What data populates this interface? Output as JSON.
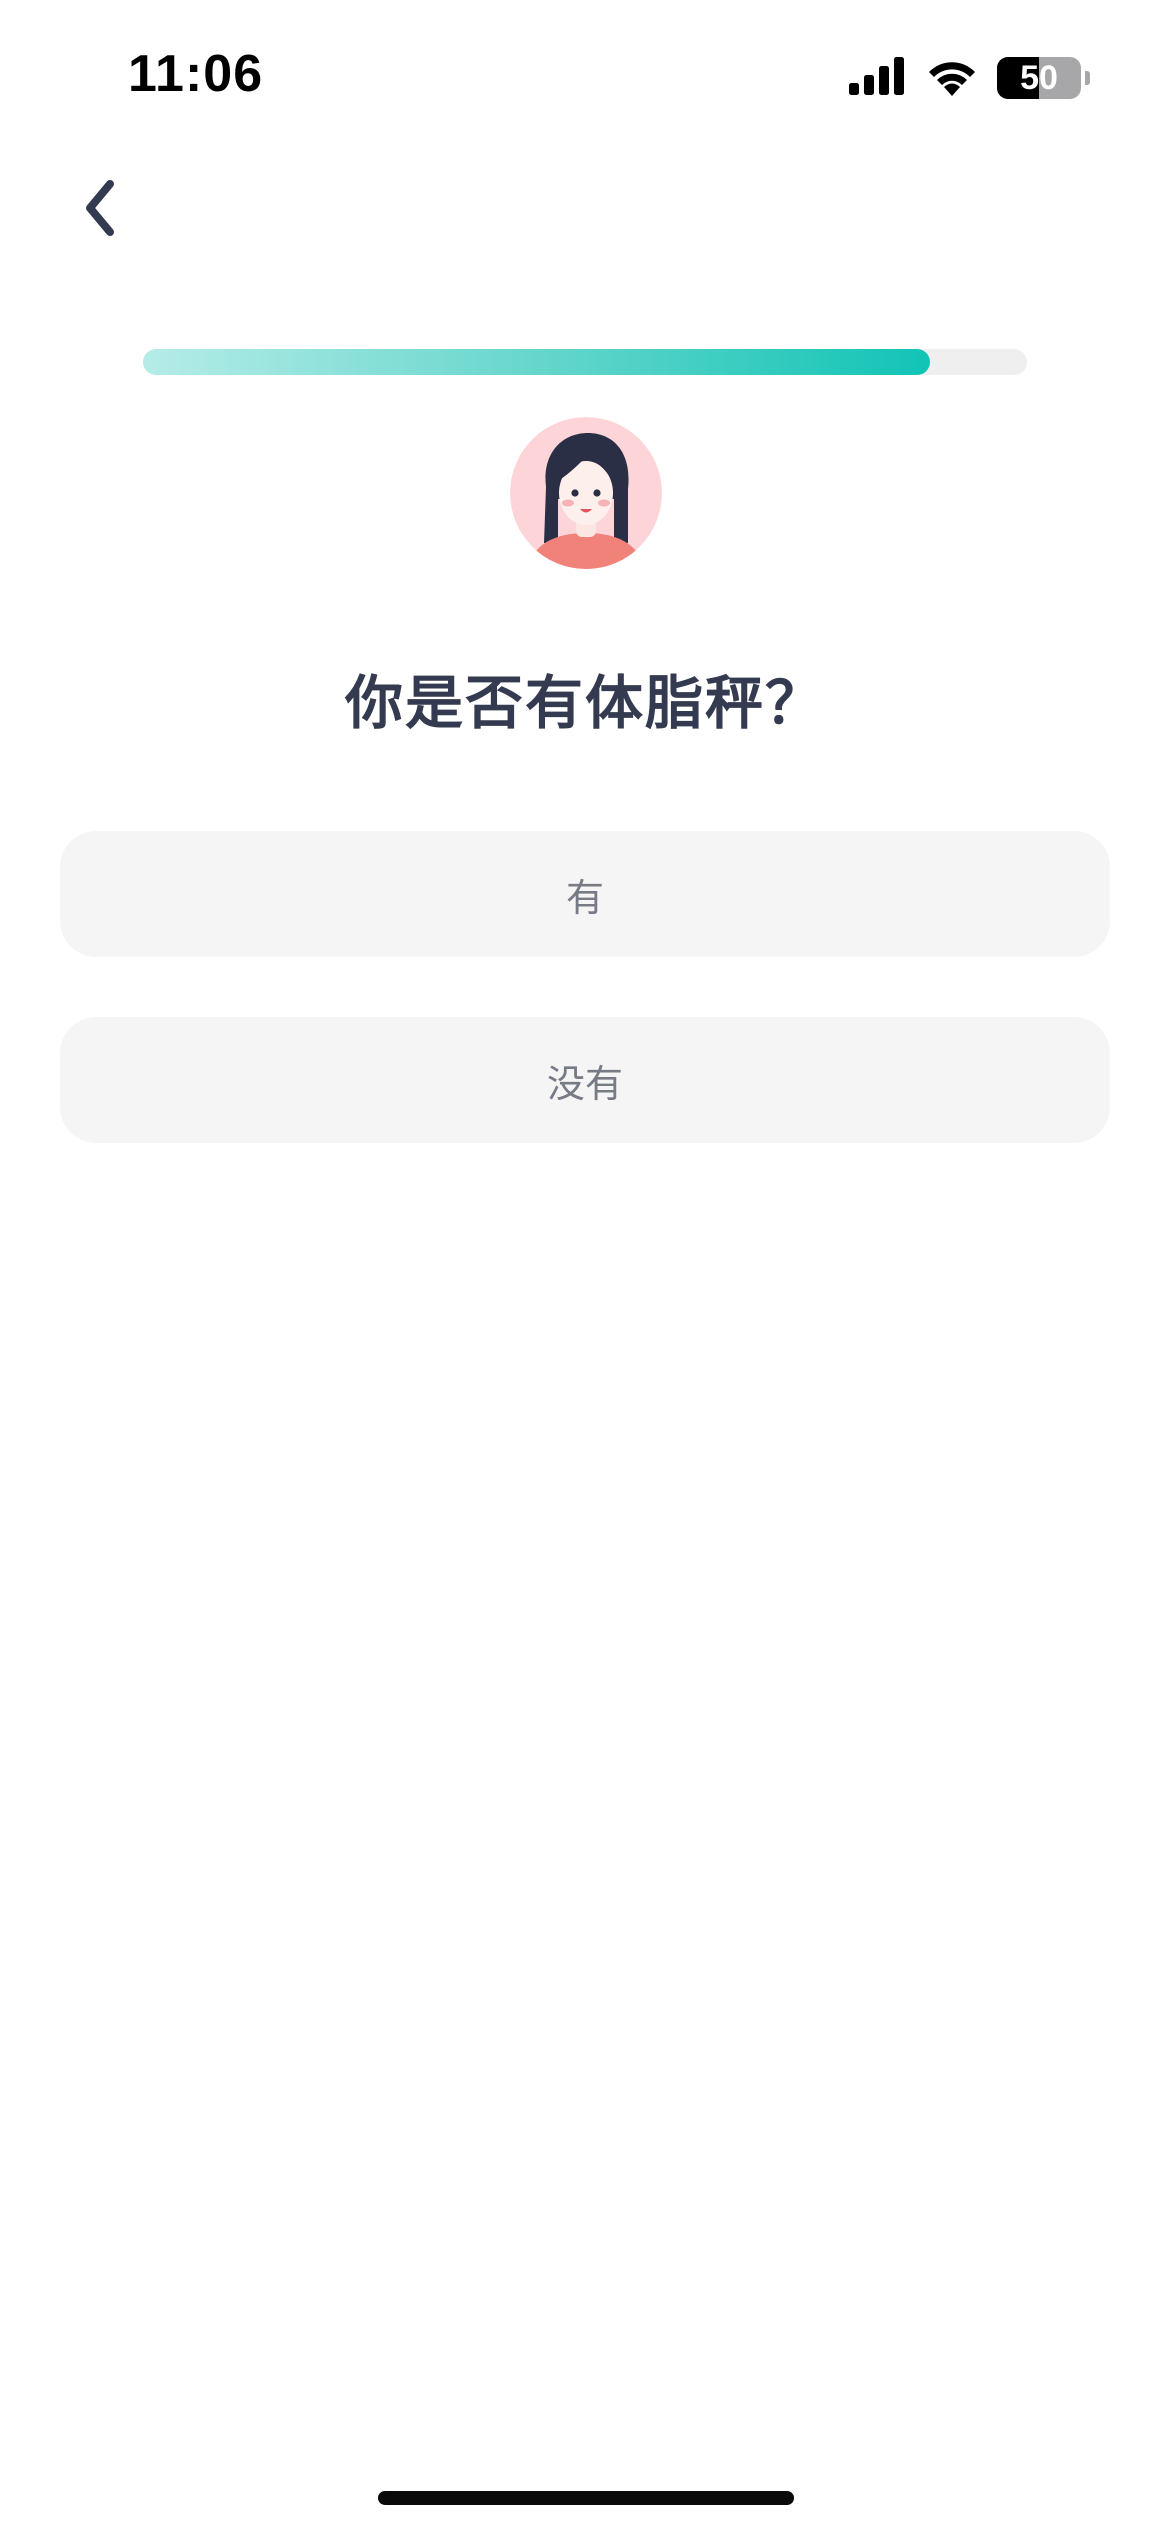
{
  "status_bar": {
    "time": "11:06",
    "battery_level": "50",
    "battery_fraction": 0.5,
    "icons": [
      "cellular-signal-icon",
      "wifi-icon",
      "battery-icon"
    ]
  },
  "nav": {
    "back_icon": "chevron-left-icon"
  },
  "progress": {
    "fraction": 0.89,
    "colors": {
      "start": "#b6ece8",
      "end": "#11c4b6",
      "track": "#efefef"
    }
  },
  "avatar": {
    "icon": "avatar-woman-illustration",
    "background": "#fdd5d8"
  },
  "question": {
    "title": "你是否有体脂秤？"
  },
  "options": [
    {
      "label": "有"
    },
    {
      "label": "没有"
    }
  ],
  "colors": {
    "title": "#343a4f",
    "option_bg": "#f5f5f5",
    "option_text": "#777b86",
    "accent": "#11c4b6"
  }
}
